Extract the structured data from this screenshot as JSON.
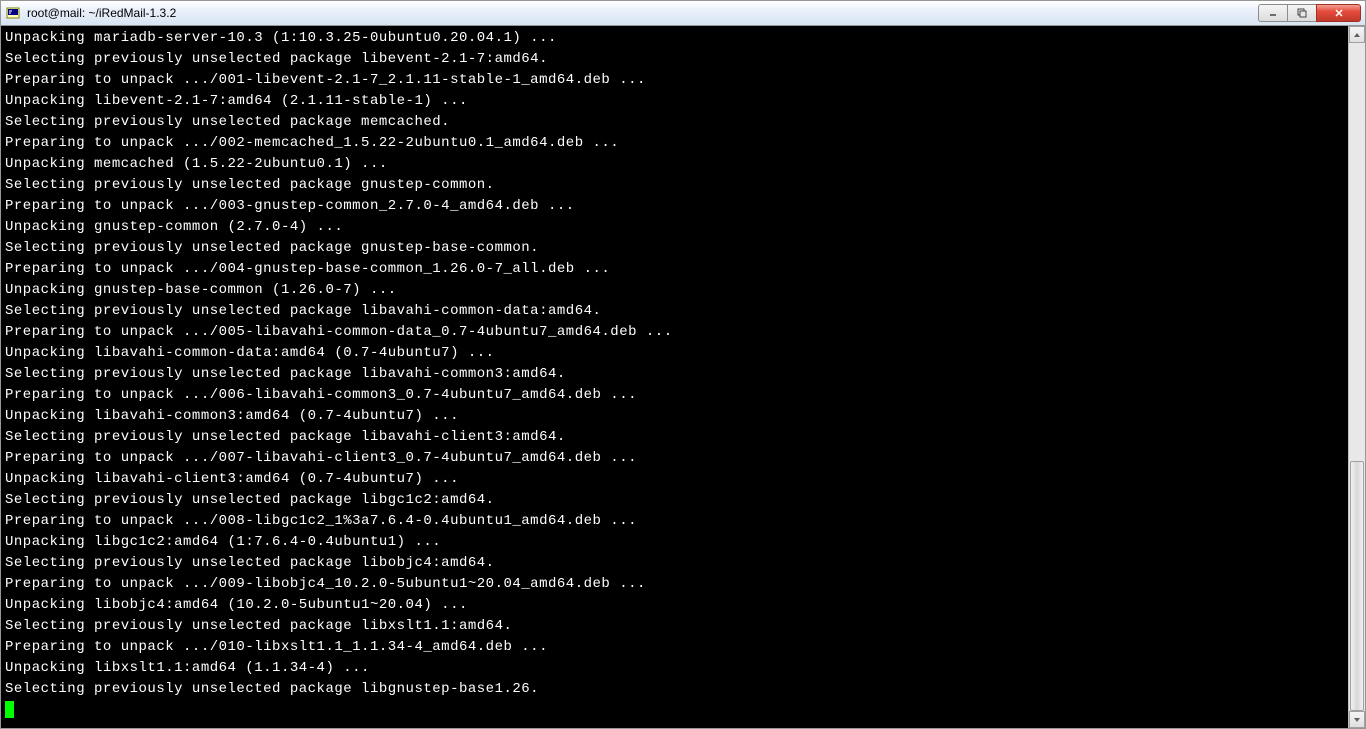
{
  "window": {
    "title": "root@mail: ~/iRedMail-1.3.2"
  },
  "terminal": {
    "lines": [
      "Unpacking mariadb-server-10.3 (1:10.3.25-0ubuntu0.20.04.1) ...",
      "Selecting previously unselected package libevent-2.1-7:amd64.",
      "Preparing to unpack .../001-libevent-2.1-7_2.1.11-stable-1_amd64.deb ...",
      "Unpacking libevent-2.1-7:amd64 (2.1.11-stable-1) ...",
      "Selecting previously unselected package memcached.",
      "Preparing to unpack .../002-memcached_1.5.22-2ubuntu0.1_amd64.deb ...",
      "Unpacking memcached (1.5.22-2ubuntu0.1) ...",
      "Selecting previously unselected package gnustep-common.",
      "Preparing to unpack .../003-gnustep-common_2.7.0-4_amd64.deb ...",
      "Unpacking gnustep-common (2.7.0-4) ...",
      "Selecting previously unselected package gnustep-base-common.",
      "Preparing to unpack .../004-gnustep-base-common_1.26.0-7_all.deb ...",
      "Unpacking gnustep-base-common (1.26.0-7) ...",
      "Selecting previously unselected package libavahi-common-data:amd64.",
      "Preparing to unpack .../005-libavahi-common-data_0.7-4ubuntu7_amd64.deb ...",
      "Unpacking libavahi-common-data:amd64 (0.7-4ubuntu7) ...",
      "Selecting previously unselected package libavahi-common3:amd64.",
      "Preparing to unpack .../006-libavahi-common3_0.7-4ubuntu7_amd64.deb ...",
      "Unpacking libavahi-common3:amd64 (0.7-4ubuntu7) ...",
      "Selecting previously unselected package libavahi-client3:amd64.",
      "Preparing to unpack .../007-libavahi-client3_0.7-4ubuntu7_amd64.deb ...",
      "Unpacking libavahi-client3:amd64 (0.7-4ubuntu7) ...",
      "Selecting previously unselected package libgc1c2:amd64.",
      "Preparing to unpack .../008-libgc1c2_1%3a7.6.4-0.4ubuntu1_amd64.deb ...",
      "Unpacking libgc1c2:amd64 (1:7.6.4-0.4ubuntu1) ...",
      "Selecting previously unselected package libobjc4:amd64.",
      "Preparing to unpack .../009-libobjc4_10.2.0-5ubuntu1~20.04_amd64.deb ...",
      "Unpacking libobjc4:amd64 (10.2.0-5ubuntu1~20.04) ...",
      "Selecting previously unselected package libxslt1.1:amd64.",
      "Preparing to unpack .../010-libxslt1.1_1.1.34-4_amd64.deb ...",
      "Unpacking libxslt1.1:amd64 (1.1.34-4) ...",
      "Selecting previously unselected package libgnustep-base1.26."
    ]
  }
}
